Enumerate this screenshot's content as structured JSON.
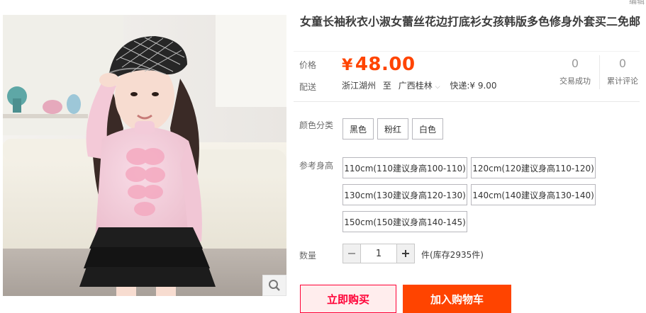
{
  "top_link": "编辑",
  "product": {
    "title": "女童长袖秋衣小淑女蕾丝花边打底衫女孩韩版多色修身外套买二免邮",
    "price_label": "价格",
    "currency": "¥",
    "price": "48.00",
    "delivery_label": "配送",
    "ship_from": "浙江湖州",
    "ship_to_prefix": "至",
    "ship_to": "广西桂林",
    "shipping_fee": "快递:¥ 9.00"
  },
  "stats": [
    {
      "value": "0",
      "label": "交易成功"
    },
    {
      "value": "0",
      "label": "累计评论"
    }
  ],
  "color": {
    "label": "颜色分类",
    "options": [
      "黑色",
      "粉红",
      "白色"
    ]
  },
  "size": {
    "label": "参考身高",
    "options": [
      "110cm(110建议身高100-110)",
      "120cm(120建议身高110-120)",
      "130cm(130建议身高120-130)",
      "140cm(140建议身高130-140)",
      "150cm(150建议身高140-145)"
    ]
  },
  "quantity": {
    "label": "数量",
    "value": "1",
    "stock": "件(库存2935件)"
  },
  "buttons": {
    "buy_now": "立即购买",
    "add_to_cart": "加入购物车"
  },
  "colors": {
    "price": "#ff4400",
    "buy_now_bg": "#ffeded",
    "buy_now_border": "#ff0036",
    "cart_bg": "#ff4400",
    "sku_border": "#b8b7bd"
  },
  "icons": [
    "zoom-icon",
    "caret-down-icon",
    "minus-icon",
    "plus-icon"
  ]
}
